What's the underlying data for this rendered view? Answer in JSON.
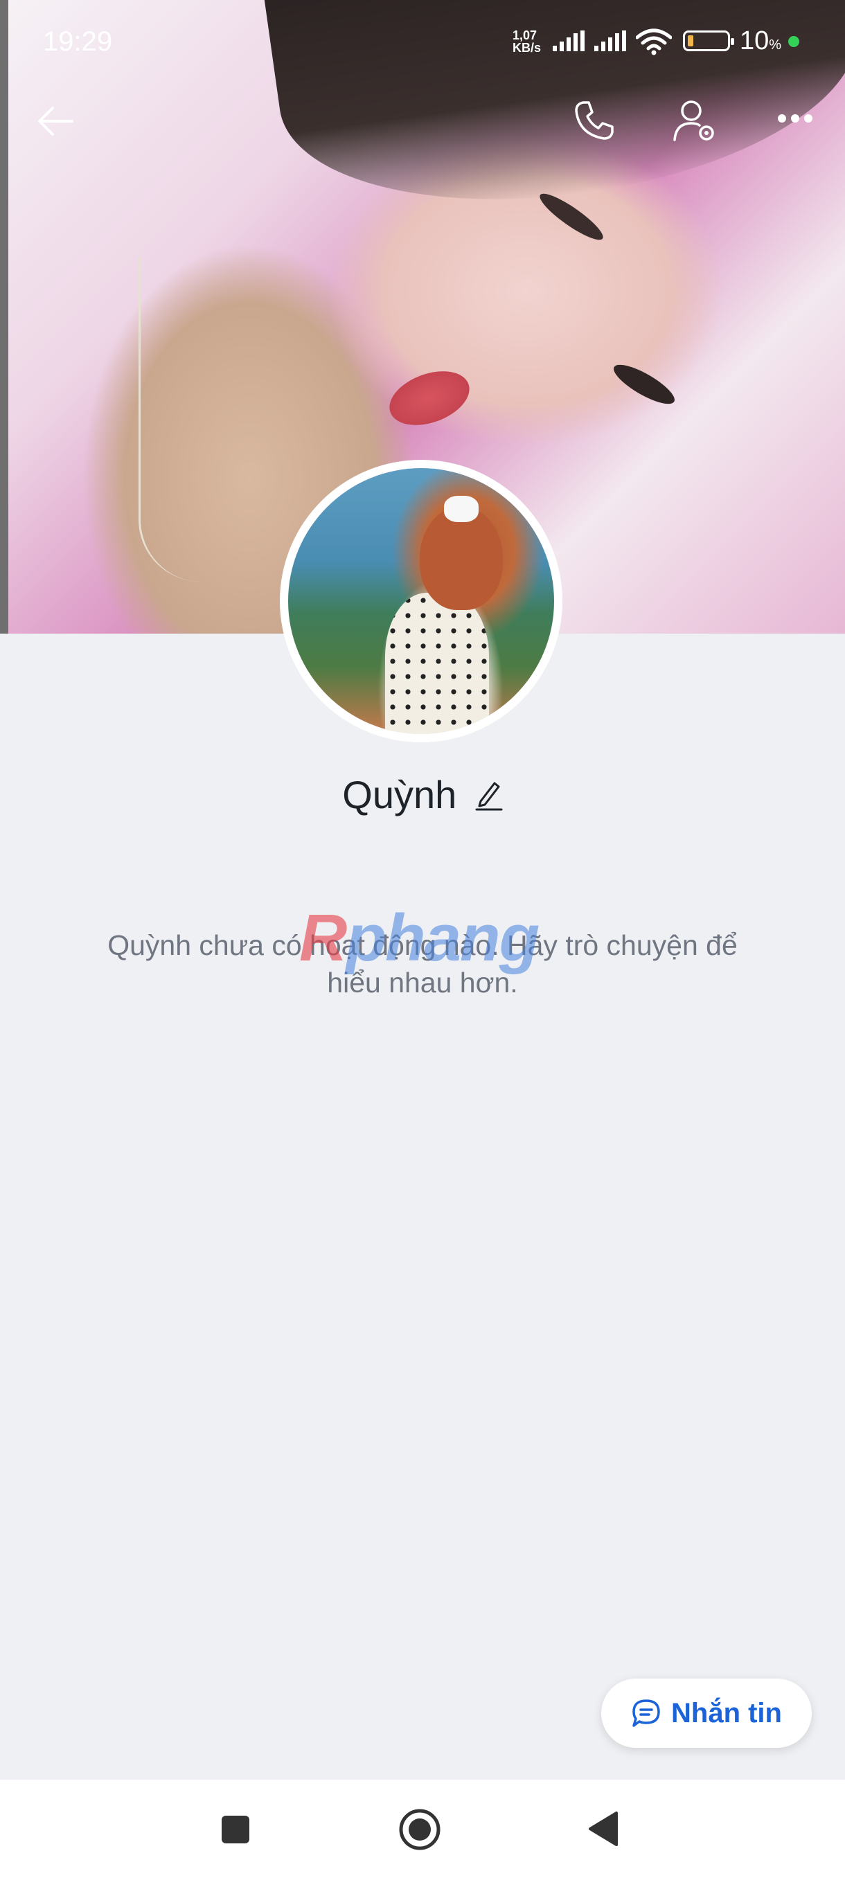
{
  "status_bar": {
    "time": "19:29",
    "net_speed_value": "1,07",
    "net_speed_unit": "KB/s",
    "battery_percent": "10",
    "battery_unit": "%"
  },
  "topbar": {
    "back_icon": "arrow-left-icon",
    "call_icon": "phone-icon",
    "profile_settings_icon": "user-gear-icon",
    "more_icon": "more-horizontal-icon"
  },
  "profile": {
    "name": "Quỳnh",
    "edit_icon": "pencil-icon",
    "empty_message": "Quỳnh chưa có hoạt động nào. Hãy trò chuyện để hiểu nhau hơn."
  },
  "watermark": {
    "first_letter": "R",
    "rest": "phang"
  },
  "actions": {
    "message_label": "Nhắn tin",
    "message_icon": "chat-bubble-icon"
  },
  "navbar": {
    "recents_icon": "square-icon",
    "home_icon": "circle-icon",
    "back_icon": "triangle-back-icon"
  },
  "colors": {
    "accent": "#1b63d6",
    "background": "#eff0f4"
  }
}
